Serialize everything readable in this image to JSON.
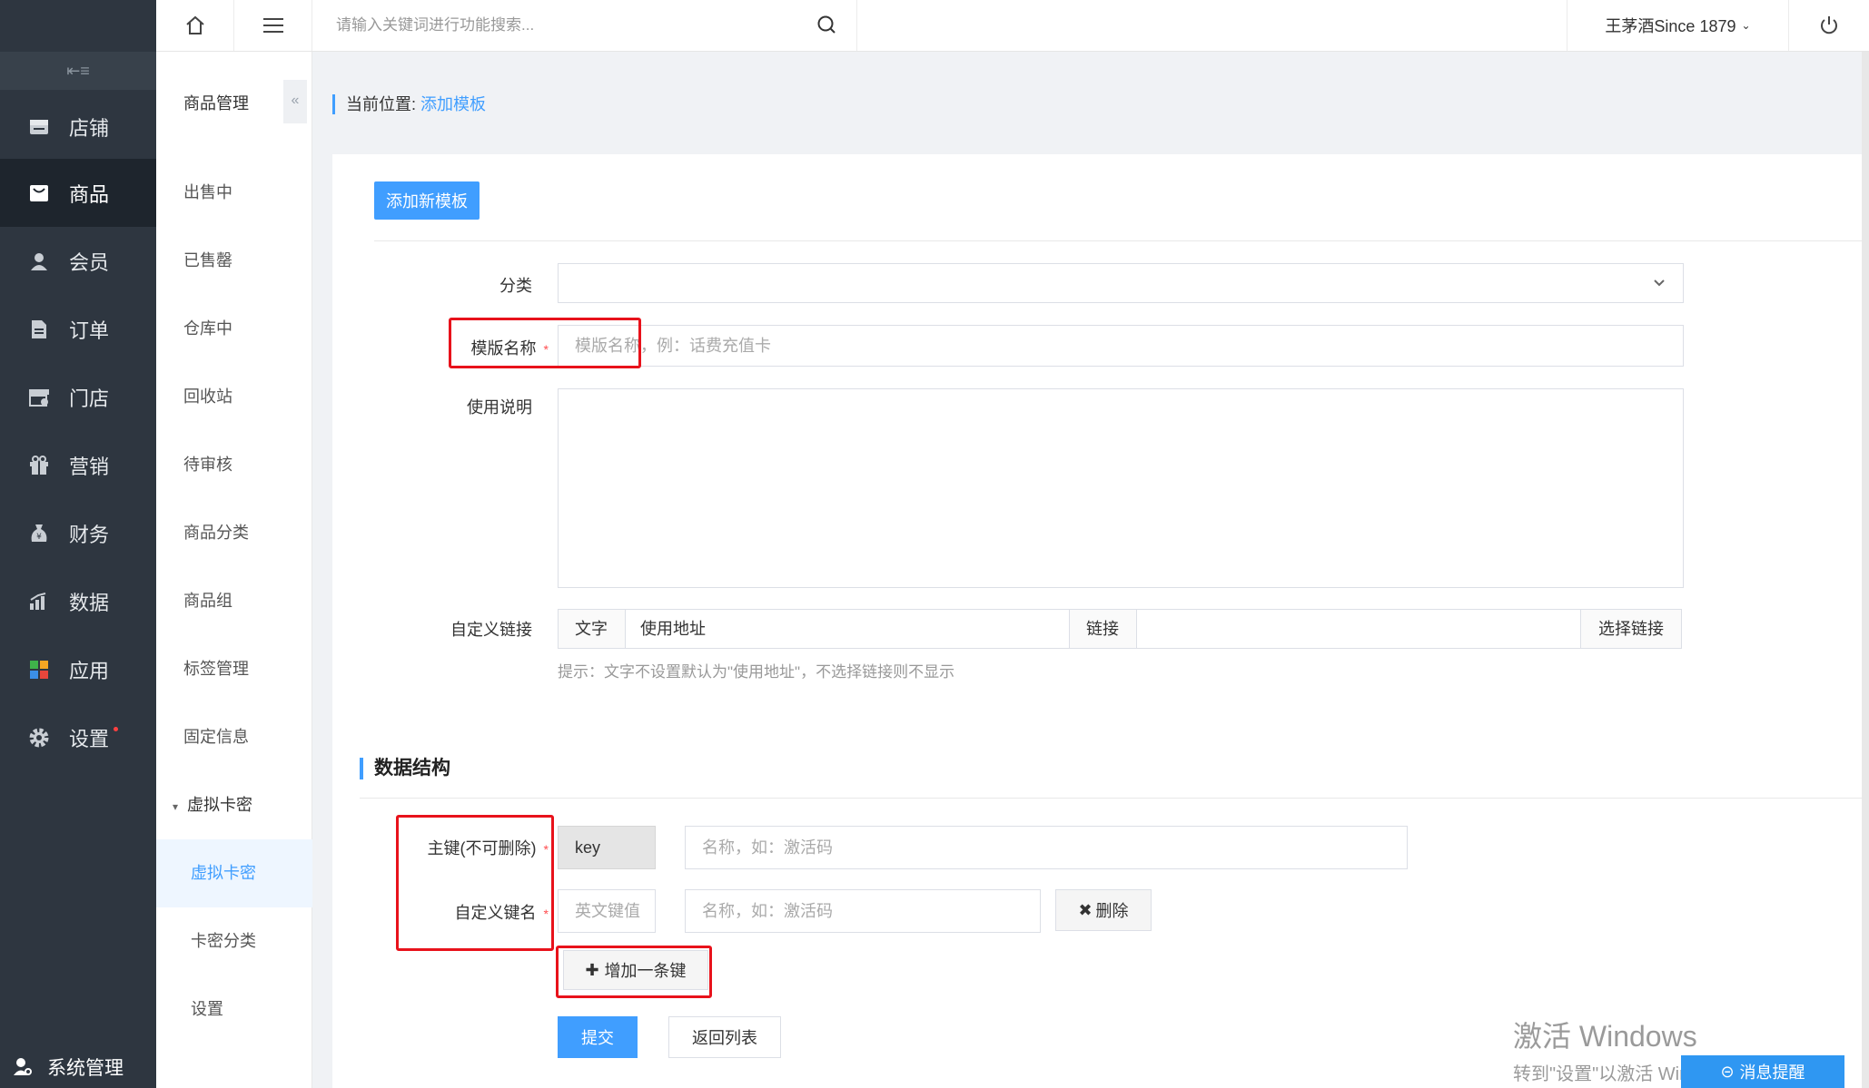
{
  "topbar": {
    "search_placeholder": "请输入关键词进行功能搜索...",
    "user": "王茅酒Since 1879"
  },
  "nav": {
    "items": [
      {
        "label": "店铺",
        "icon": "store-icon"
      },
      {
        "label": "商品",
        "icon": "goods-icon"
      },
      {
        "label": "会员",
        "icon": "member-icon"
      },
      {
        "label": "订单",
        "icon": "order-icon"
      },
      {
        "label": "门店",
        "icon": "shop-icon"
      },
      {
        "label": "营销",
        "icon": "gift-icon"
      },
      {
        "label": "财务",
        "icon": "money-bag-icon"
      },
      {
        "label": "数据",
        "icon": "bar-chart-icon"
      },
      {
        "label": "应用",
        "icon": "apps-icon"
      },
      {
        "label": "设置",
        "icon": "gear-icon"
      }
    ],
    "active": "商品",
    "system": "系统管理"
  },
  "subnav": {
    "title": "商品管理",
    "items": [
      "出售中",
      "已售罄",
      "仓库中",
      "回收站",
      "待审核",
      "商品分类",
      "商品组",
      "标签管理",
      "固定信息"
    ],
    "group": "虚拟卡密",
    "children": [
      "虚拟卡密",
      "卡密分类",
      "设置"
    ],
    "active_child": "虚拟卡密"
  },
  "breadcrumb": {
    "prefix": "当前位置:",
    "current": "添加模板"
  },
  "form": {
    "add_button": "添加新模板",
    "category_label": "分类",
    "category_value": "",
    "name_label": "模版名称",
    "name_placeholder": "模版名称，例：话费充值卡",
    "usage_label": "使用说明",
    "link_label": "自定义链接",
    "link_text_addon": "文字",
    "link_text_value": "使用地址",
    "link_addon": "链接",
    "link_value": "",
    "link_select": "选择链接",
    "hint": "提示：文字不设置默认为\"使用地址\"，不选择链接则不显示",
    "section_title": "数据结构",
    "primary_key_label": "主键(不可删除)",
    "primary_key_value": "key",
    "primary_key_name_placeholder": "名称，如：激活码",
    "custom_key_label": "自定义键名",
    "custom_key_placeholder": "英文键值",
    "custom_key_name_placeholder": "名称，如：激活码",
    "delete_button": "删除",
    "add_key_button": "增加一条键",
    "submit": "提交",
    "back": "返回列表"
  },
  "watermark": {
    "line1": "激活 Windows",
    "line2": "转到\"设置\"以激活 Windows。"
  },
  "message_button": "消息提醒",
  "colors": {
    "accent": "#409eff",
    "sidebar": "#2e3640",
    "highlight": "#e8121b"
  }
}
